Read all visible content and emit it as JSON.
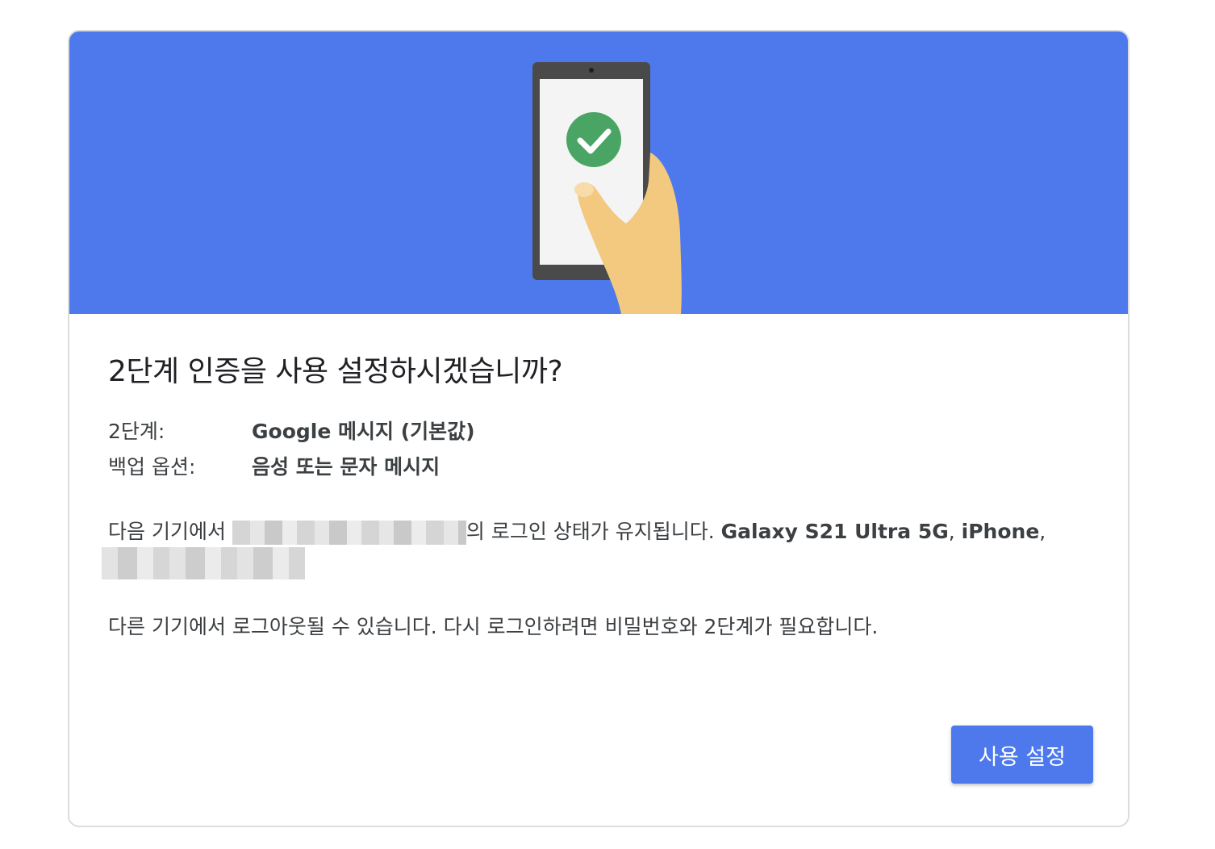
{
  "dialog": {
    "title": "2단계 인증을 사용 설정하시겠습니까?",
    "second_step_label": "2단계:",
    "second_step_value": "Google 메시지 (기본값)",
    "backup_label": "백업 옵션:",
    "backup_value": "음성 또는 문자 메시지",
    "devices_prefix": "다음 기기에서",
    "devices_middle": "의 로그인 상태가 유지됩니다.",
    "device_1": "Galaxy S21 Ultra 5G",
    "separator": ",",
    "device_2": "iPhone",
    "logout_notice": "다른 기기에서 로그아웃될 수 있습니다. 다시 로그인하려면 비밀번호와 2단계가 필요합니다.",
    "enable_button": "사용 설정"
  },
  "colors": {
    "hero_background": "#4d79ec",
    "button_background": "#4d79ec",
    "check_circle": "#4aa564"
  },
  "icons": {
    "hero": "phone-in-hand-illustration",
    "check": "check-circle-icon"
  }
}
